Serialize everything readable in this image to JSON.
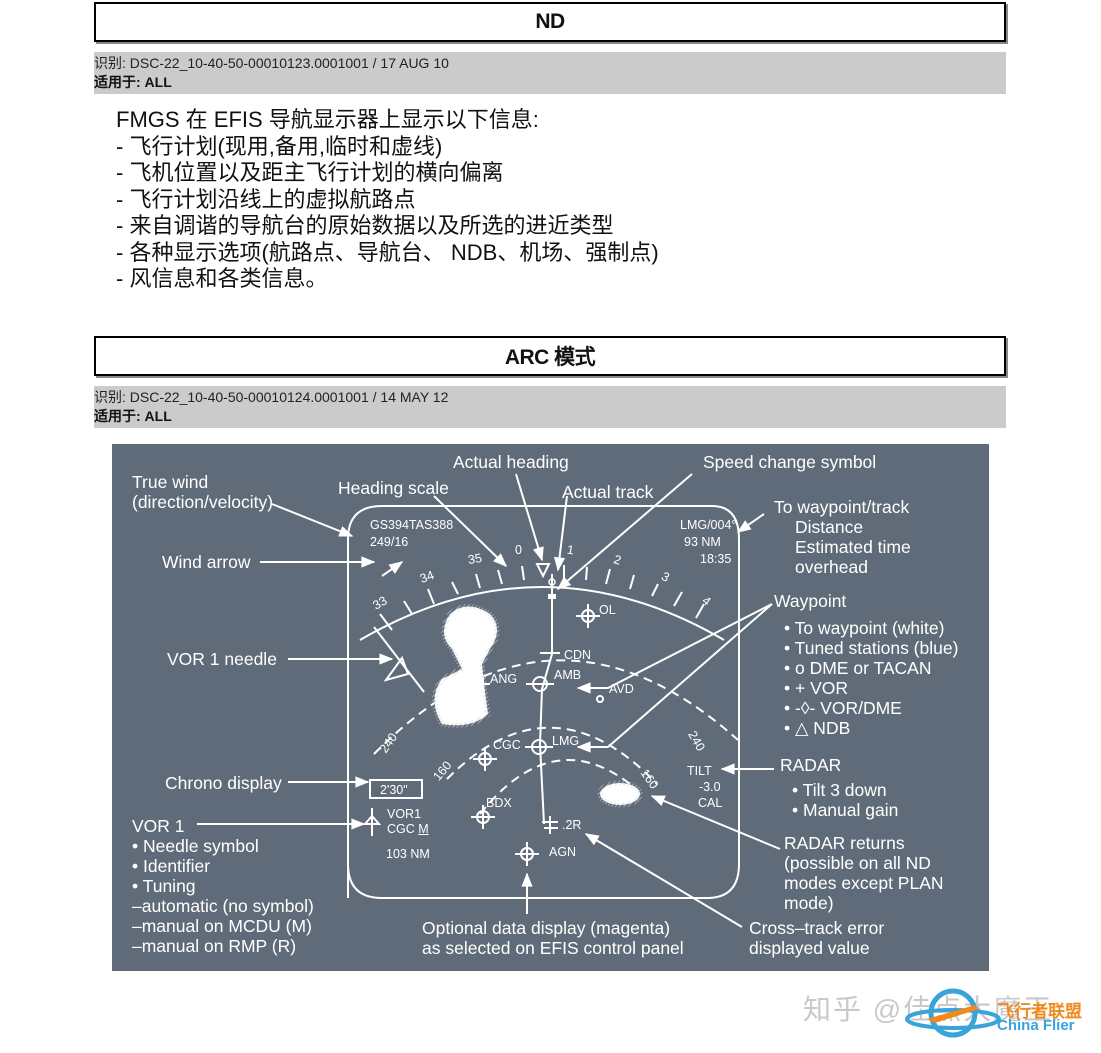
{
  "section1": {
    "title": "ND",
    "id_line": "识别: DSC-22_10-40-50-00010123.0001001 / 17 AUG 10",
    "applies_line": "适用于: ALL",
    "intro": "FMGS 在 EFIS 导航显示器上显示以下信息:",
    "bullets": [
      "- 飞行计划(现用,备用,临时和虚线)",
      "- 飞机位置以及距主飞行计划的横向偏离",
      "- 飞行计划沿线上的虚拟航路点",
      "- 来自调谐的导航台的原始数据以及所选的进近类型",
      "- 各种显示选项(航路点、导航台、 NDB、机场、强制点)",
      "- 风信息和各类信息。"
    ]
  },
  "section2": {
    "title": "ARC 模式",
    "id_line": "识别: DSC-22_10-40-50-00010124.0001001 / 14 MAY 12",
    "applies_line": "适用于: ALL"
  },
  "diagram": {
    "colors": {
      "background": "#5f6b78",
      "foreground": "#ffffff"
    },
    "callouts": {
      "true_wind": [
        "True wind",
        "(direction/velocity)"
      ],
      "heading_scale": "Heading scale",
      "actual_heading": "Actual heading",
      "actual_track": "Actual track",
      "speed_change": "Speed change symbol",
      "to_waypoint": [
        "To waypoint/track",
        "Distance",
        "Estimated time",
        "overhead"
      ],
      "wind_arrow": "Wind arrow",
      "waypoint": "Waypoint",
      "waypoint_items": [
        "• To waypoint (white)",
        "• Tuned stations (blue)",
        "•  o DME or TACAN",
        "•  + VOR",
        "•  -◊- VOR/DME",
        "•  △ NDB"
      ],
      "vor1_needle": "VOR 1 needle",
      "radar": "RADAR",
      "radar_items": [
        "• Tilt 3 down",
        "• Manual gain"
      ],
      "chrono": "Chrono display",
      "vor1": "VOR 1",
      "vor1_items": [
        "• Needle symbol",
        "• Identifier",
        "• Tuning",
        "–automatic (no symbol)",
        "–manual on MCDU (M)",
        "–manual on RMP (R)"
      ],
      "radar_returns": [
        "RADAR returns",
        "(possible on all ND",
        "modes except PLAN",
        "mode)"
      ],
      "optional_data": [
        "Optional data display (magenta)",
        "as selected on EFIS control panel"
      ],
      "cross_track": [
        "Cross–track error",
        "displayed value"
      ]
    },
    "display": {
      "gs_tas": "GS394TAS388",
      "wind": "249/16",
      "to_wpt": "LMG/004°",
      "distance": "93 NM",
      "eta": "18:35",
      "heading_ticks": [
        "33",
        "34",
        "35",
        "0",
        "1",
        "2",
        "3",
        "4"
      ],
      "range_labels": [
        "240",
        "160",
        "240",
        "160"
      ],
      "waypoints": [
        "OL",
        "CDN",
        "AMB",
        "ANG",
        "AVD",
        "CGC",
        "LMG",
        "BDX",
        "AGN"
      ],
      "xtk": ".2R",
      "chrono": "2'30\"",
      "vor1_label": "VOR1",
      "vor1_ident": "CGC",
      "vor1_tuning": "M",
      "vor1_dist": "103 NM",
      "tilt": "TILT",
      "tilt_value": "-3.0",
      "gain": "CAL"
    }
  },
  "watermark": {
    "text": "知乎 @佳点大魔王",
    "logo_cn": "飞行者联盟",
    "logo_en": "China Flier"
  }
}
